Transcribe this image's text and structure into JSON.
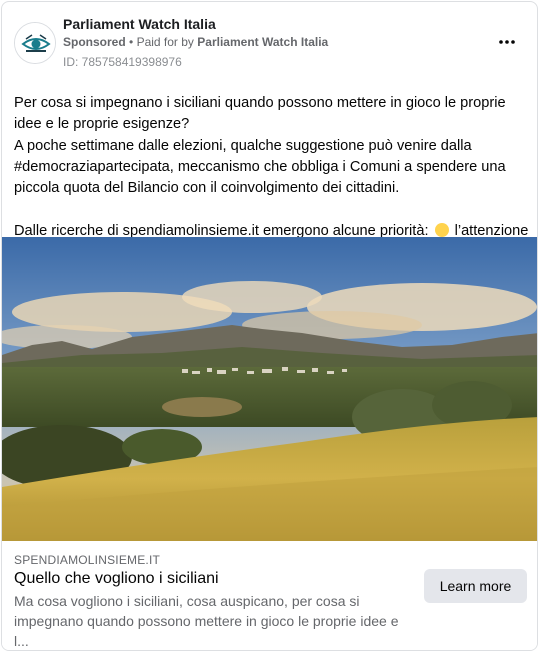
{
  "post": {
    "page_name": "Parliament Watch Italia",
    "sponsored_label": "Sponsored",
    "separator": "•",
    "paid_for_prefix": "Paid for by",
    "paid_for_by": "Parliament Watch Italia",
    "ad_id": "ID: 785758419398976",
    "more_icon": "more-horizontal-icon"
  },
  "body": {
    "line1": "Per cosa si impegnano i siciliani quando possono mettere in gioco le proprie idee e le proprie esigenze?",
    "line2": "A poche settimane dalle elezioni, qualche suggestione può venire dalla #democraziapartecipata, meccanismo che obbliga i Comuni a spendere una piccola quota del Bilancio con il coinvolgimento dei cittadini.",
    "line3_before_emoji": "Dalle ricerche di spendiamolinsieme.it emergono alcune priorità:",
    "line3_after_emoji": "l’attenzione…"
  },
  "link_card": {
    "domain": "SPENDIAMOLINSIEME.IT",
    "headline": "Quello che vogliono i siciliani",
    "description": "Ma cosa vogliono i siciliani, cosa auspicano, per cosa si impegnano quando possono mettere in gioco le proprie idee e l...",
    "cta_label": "Learn more"
  },
  "colors": {
    "secondary_text": "#65676b",
    "button_bg": "#e4e6eb",
    "border": "#dddfe2"
  }
}
